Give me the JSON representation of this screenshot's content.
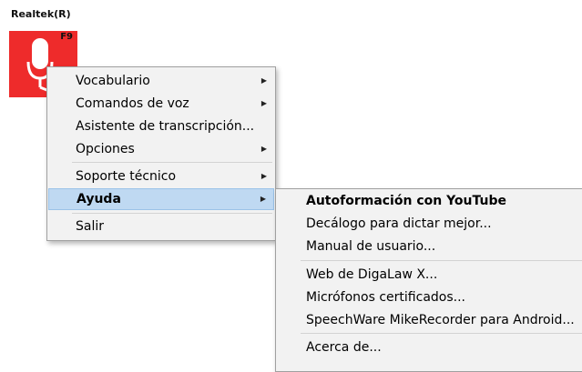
{
  "device": {
    "label": "Realtek(R)"
  },
  "tile": {
    "hotkey": "F9",
    "icon": "microphone-icon",
    "color": "#ee2b2b"
  },
  "main_menu": {
    "items": [
      {
        "label": "Vocabulario",
        "submenu": true
      },
      {
        "label": "Comandos de voz",
        "submenu": true
      },
      {
        "label": "Asistente de transcripción...",
        "submenu": false
      },
      {
        "label": "Opciones",
        "submenu": true
      },
      {
        "label": "Soporte técnico",
        "submenu": true
      },
      {
        "label": "Ayuda",
        "submenu": true,
        "highlighted": true
      },
      {
        "label": "Salir",
        "submenu": false
      }
    ],
    "arrow": "▶"
  },
  "sub_menu": {
    "items": [
      {
        "label": "Autoformación con YouTube",
        "bold": true
      },
      {
        "label": "Decálogo para dictar mejor..."
      },
      {
        "label": "Manual de usuario..."
      },
      {
        "label": "Web de DigaLaw X..."
      },
      {
        "label": "Micrófonos certificados..."
      },
      {
        "label": "SpeechWare MikeRecorder para Android..."
      },
      {
        "label": "Acerca de..."
      }
    ]
  },
  "colors": {
    "highlight": "#bfd9f2",
    "menu_bg": "#f2f2f2"
  }
}
